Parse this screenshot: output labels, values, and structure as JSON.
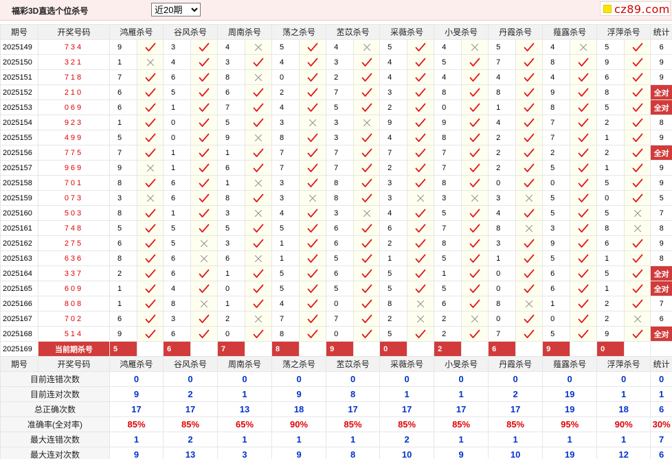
{
  "header": {
    "title": "福彩3D直选个位杀号",
    "period_selected": "近20期",
    "period_options": [
      "近20期"
    ],
    "logo_text": "cz89.com"
  },
  "columns": {
    "issue": "期号",
    "number": "开奖号码",
    "total": "统计",
    "experts": [
      "鸿雁杀号",
      "谷风杀号",
      "周南杀号",
      "荡之杀号",
      "苤苡杀号",
      "采薇杀号",
      "小旻杀号",
      "丹霞杀号",
      "薤露杀号",
      "浮萍杀号"
    ]
  },
  "rows": [
    {
      "issue": "2025149",
      "num": "734",
      "k": [
        9,
        3,
        4,
        5,
        4,
        5,
        4,
        5,
        4,
        5
      ],
      "r": [
        1,
        1,
        0,
        1,
        0,
        1,
        0,
        1,
        0,
        1
      ],
      "total": "6"
    },
    {
      "issue": "2025150",
      "num": "321",
      "k": [
        1,
        4,
        3,
        4,
        3,
        4,
        5,
        7,
        8,
        9
      ],
      "r": [
        0,
        1,
        1,
        1,
        1,
        1,
        1,
        1,
        1,
        1
      ],
      "total": "9"
    },
    {
      "issue": "2025151",
      "num": "718",
      "k": [
        7,
        6,
        8,
        0,
        2,
        4,
        4,
        4,
        4,
        6
      ],
      "r": [
        1,
        1,
        0,
        1,
        1,
        1,
        1,
        1,
        1,
        1
      ],
      "total": "9"
    },
    {
      "issue": "2025152",
      "num": "210",
      "k": [
        6,
        5,
        6,
        2,
        7,
        3,
        8,
        8,
        9,
        8
      ],
      "r": [
        1,
        1,
        1,
        1,
        1,
        1,
        1,
        1,
        1,
        1
      ],
      "total": "全对"
    },
    {
      "issue": "2025153",
      "num": "069",
      "k": [
        6,
        1,
        7,
        4,
        5,
        2,
        0,
        1,
        8,
        5
      ],
      "r": [
        1,
        1,
        1,
        1,
        1,
        1,
        1,
        1,
        1,
        1
      ],
      "total": "全对"
    },
    {
      "issue": "2025154",
      "num": "923",
      "k": [
        1,
        0,
        5,
        3,
        3,
        9,
        9,
        4,
        7,
        2
      ],
      "r": [
        1,
        1,
        1,
        0,
        0,
        1,
        1,
        1,
        1,
        1
      ],
      "total": "8"
    },
    {
      "issue": "2025155",
      "num": "499",
      "k": [
        5,
        0,
        9,
        8,
        3,
        4,
        8,
        2,
        7,
        1
      ],
      "r": [
        1,
        1,
        0,
        1,
        1,
        1,
        1,
        1,
        1,
        1
      ],
      "total": "9"
    },
    {
      "issue": "2025156",
      "num": "775",
      "k": [
        7,
        1,
        1,
        7,
        7,
        7,
        7,
        2,
        2,
        2
      ],
      "r": [
        1,
        1,
        1,
        1,
        1,
        1,
        1,
        1,
        1,
        1
      ],
      "total": "全对"
    },
    {
      "issue": "2025157",
      "num": "969",
      "k": [
        9,
        1,
        6,
        7,
        7,
        2,
        7,
        2,
        5,
        1
      ],
      "r": [
        0,
        1,
        1,
        1,
        1,
        1,
        1,
        1,
        1,
        1
      ],
      "total": "9"
    },
    {
      "issue": "2025158",
      "num": "701",
      "k": [
        8,
        6,
        1,
        3,
        8,
        3,
        8,
        0,
        0,
        5
      ],
      "r": [
        1,
        1,
        0,
        1,
        1,
        1,
        1,
        1,
        1,
        1
      ],
      "total": "9"
    },
    {
      "issue": "2025159",
      "num": "073",
      "k": [
        3,
        6,
        8,
        3,
        8,
        3,
        3,
        3,
        5,
        0
      ],
      "r": [
        0,
        1,
        1,
        0,
        1,
        0,
        0,
        0,
        1,
        1
      ],
      "total": "5"
    },
    {
      "issue": "2025160",
      "num": "503",
      "k": [
        8,
        1,
        3,
        4,
        3,
        4,
        5,
        4,
        5,
        5
      ],
      "r": [
        1,
        1,
        0,
        1,
        0,
        1,
        1,
        1,
        1,
        0
      ],
      "total": "7"
    },
    {
      "issue": "2025161",
      "num": "748",
      "k": [
        5,
        5,
        5,
        5,
        6,
        6,
        7,
        8,
        3,
        8
      ],
      "r": [
        1,
        1,
        1,
        1,
        1,
        1,
        1,
        0,
        1,
        0
      ],
      "total": "8"
    },
    {
      "issue": "2025162",
      "num": "275",
      "k": [
        6,
        5,
        3,
        1,
        6,
        2,
        8,
        3,
        9,
        6
      ],
      "r": [
        1,
        0,
        1,
        1,
        1,
        1,
        1,
        1,
        1,
        1
      ],
      "total": "9"
    },
    {
      "issue": "2025163",
      "num": "636",
      "k": [
        8,
        6,
        6,
        1,
        5,
        1,
        5,
        1,
        5,
        1
      ],
      "r": [
        1,
        0,
        0,
        1,
        1,
        1,
        1,
        1,
        1,
        1
      ],
      "total": "8"
    },
    {
      "issue": "2025164",
      "num": "337",
      "k": [
        2,
        6,
        1,
        5,
        6,
        5,
        1,
        0,
        6,
        5
      ],
      "r": [
        1,
        1,
        1,
        1,
        1,
        1,
        1,
        1,
        1,
        1
      ],
      "total": "全对"
    },
    {
      "issue": "2025165",
      "num": "609",
      "k": [
        1,
        4,
        0,
        5,
        5,
        5,
        5,
        0,
        6,
        1
      ],
      "r": [
        1,
        1,
        1,
        1,
        1,
        1,
        1,
        1,
        1,
        1
      ],
      "total": "全对"
    },
    {
      "issue": "2025166",
      "num": "808",
      "k": [
        1,
        8,
        1,
        4,
        0,
        8,
        6,
        8,
        1,
        2
      ],
      "r": [
        1,
        0,
        1,
        1,
        1,
        0,
        1,
        0,
        1,
        1
      ],
      "total": "7"
    },
    {
      "issue": "2025167",
      "num": "702",
      "k": [
        6,
        3,
        2,
        7,
        7,
        2,
        2,
        0,
        0,
        2
      ],
      "r": [
        1,
        1,
        0,
        1,
        1,
        0,
        0,
        1,
        1,
        0
      ],
      "total": "6"
    },
    {
      "issue": "2025168",
      "num": "514",
      "k": [
        9,
        6,
        0,
        8,
        0,
        5,
        2,
        7,
        5,
        9
      ],
      "r": [
        1,
        1,
        1,
        1,
        1,
        1,
        1,
        1,
        1,
        1
      ],
      "total": "全对"
    }
  ],
  "current": {
    "issue": "2025169",
    "label": "当前期杀号",
    "k": [
      "5",
      "6",
      "7",
      "8",
      "9",
      "0",
      "2",
      "6",
      "9",
      "0"
    ]
  },
  "stats": [
    {
      "label": "目前连错次数",
      "values": [
        "0",
        "0",
        "0",
        "0",
        "0",
        "0",
        "0",
        "0",
        "0",
        "0"
      ],
      "total": "0",
      "red": false
    },
    {
      "label": "目前连对次数",
      "values": [
        "9",
        "2",
        "1",
        "9",
        "8",
        "1",
        "1",
        "2",
        "19",
        "1"
      ],
      "total": "1",
      "red": false
    },
    {
      "label": "总正确次数",
      "values": [
        "17",
        "17",
        "13",
        "18",
        "17",
        "17",
        "17",
        "17",
        "19",
        "18"
      ],
      "total": "6",
      "red": false
    },
    {
      "label": "准确率(全对率)",
      "values": [
        "85%",
        "85%",
        "65%",
        "90%",
        "85%",
        "85%",
        "85%",
        "85%",
        "95%",
        "90%"
      ],
      "total": "30%",
      "red": true
    },
    {
      "label": "最大连错次数",
      "values": [
        "1",
        "2",
        "1",
        "1",
        "1",
        "2",
        "1",
        "1",
        "1",
        "1"
      ],
      "total": "7",
      "red": false
    },
    {
      "label": "最大连对次数",
      "values": [
        "9",
        "13",
        "3",
        "9",
        "8",
        "10",
        "9",
        "10",
        "19",
        "12"
      ],
      "total": "6",
      "red": false
    }
  ],
  "colors": {
    "accent": "#d23b3b",
    "check": "#e01818",
    "cross": "#999999",
    "stat_blue": "#0033cc"
  }
}
